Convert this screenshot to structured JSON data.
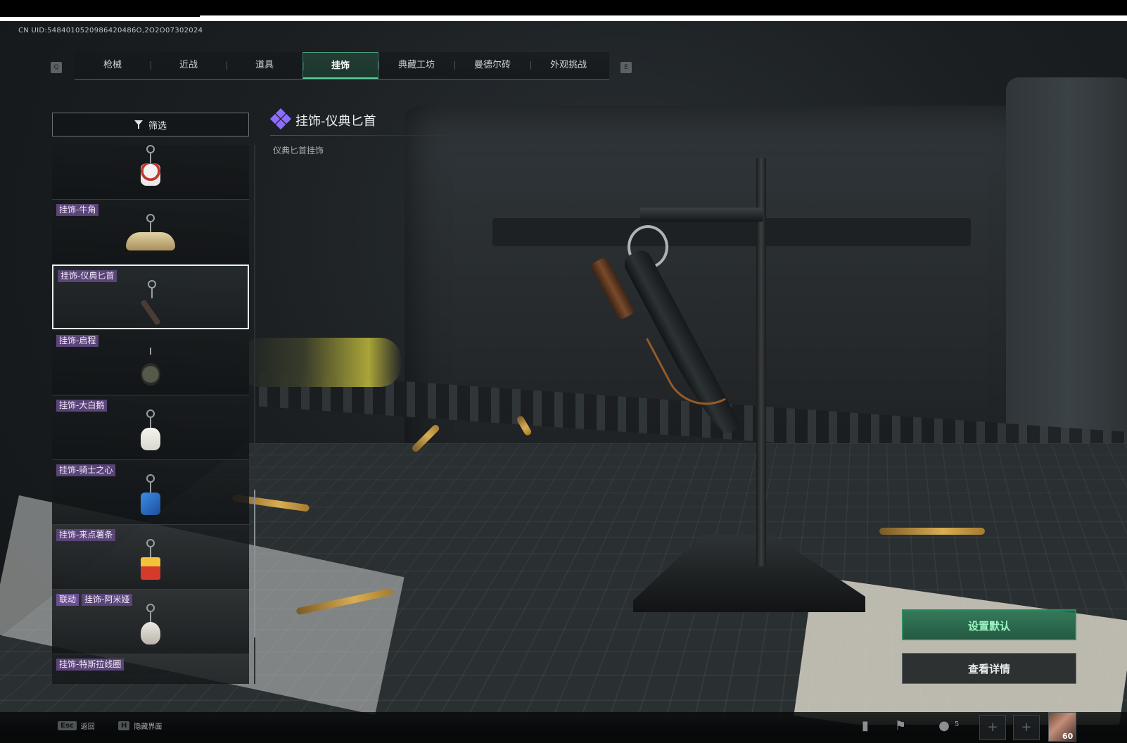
{
  "uid": "CN UID:5484010520986420486O,2O2O07302024",
  "nav": {
    "prev_key": "Q",
    "next_key": "E",
    "tabs": [
      {
        "label": "枪械"
      },
      {
        "label": "近战"
      },
      {
        "label": "道具"
      },
      {
        "label": "挂饰",
        "active": true
      },
      {
        "label": "典藏工坊"
      },
      {
        "label": "曼德尔砖"
      },
      {
        "label": "外观挑战"
      }
    ]
  },
  "filter": {
    "label": "筛选"
  },
  "selected_item": {
    "title": "挂饰-仪典匕首",
    "subtitle": "仪典匕首挂饰"
  },
  "list": {
    "items": [
      {
        "label": "",
        "charm": "snowman-charm-icon",
        "color": "#d8d8d8"
      },
      {
        "label": "挂饰-牛角",
        "charm": "bull-horn-charm-icon",
        "color": "#cbb78a"
      },
      {
        "label": "挂饰-仪典匕首",
        "charm": "dagger-charm-icon",
        "color": "#5a4a40",
        "selected": true
      },
      {
        "label": "挂饰-启程",
        "charm": "triangle-badge-charm-icon",
        "color": "#5a5e4a"
      },
      {
        "label": "挂饰-大白鹅",
        "charm": "goose-charm-icon",
        "color": "#f0f0e8"
      },
      {
        "label": "挂饰-骑士之心",
        "charm": "knight-heart-charm-icon",
        "color": "#2f7fd9"
      },
      {
        "label": "挂饰-来点薯条",
        "charm": "fries-charm-icon",
        "color": "#e0a22a"
      },
      {
        "label": "挂饰-阿米娅",
        "collab": "联动",
        "charm": "amiya-charm-icon",
        "color": "#e6e4df"
      },
      {
        "label": "挂饰-特斯拉线圈",
        "charm": "tesla-coil-charm-icon",
        "color": "#7a7f82"
      }
    ]
  },
  "actions": {
    "set_default": "设置默认",
    "view_details": "查看详情"
  },
  "bottom": {
    "esc_key": "Esc",
    "esc_label": "返回",
    "hide_key": "H",
    "hide_label": "隐藏界面",
    "friend_count": "5",
    "avatar_level": "60"
  }
}
